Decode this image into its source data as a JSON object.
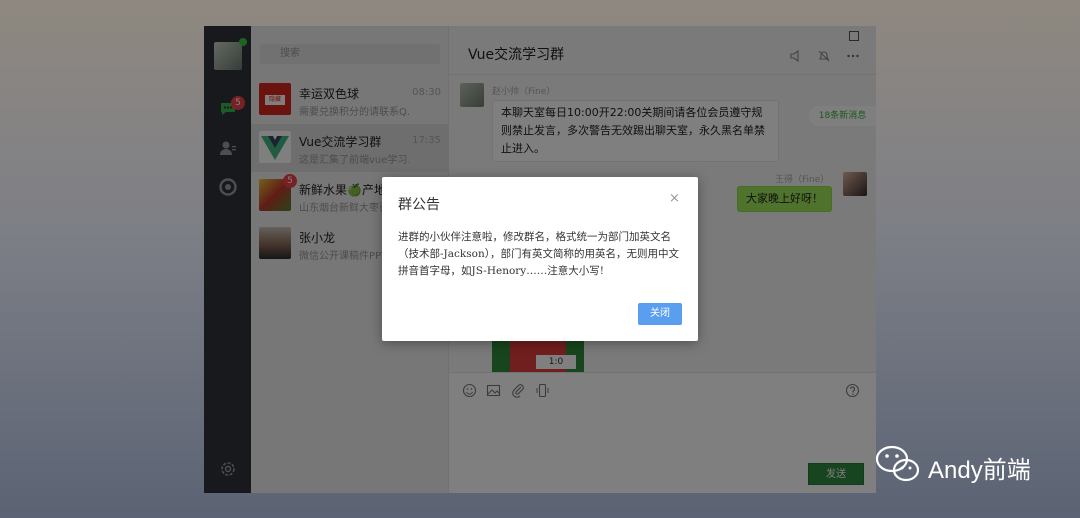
{
  "sidebar": {
    "chat_badge": "5"
  },
  "search": {
    "placeholder": "搜索"
  },
  "chats": [
    {
      "name": "幸运双色球",
      "preview": "需要兑换积分的请联系Q...",
      "time": "08:30",
      "avatar_label": "隐藏",
      "badge": ""
    },
    {
      "name": "Vue交流学习群",
      "preview": "这是汇集了前端vue学习...",
      "time": "17:35",
      "avatar_label": "",
      "badge": ""
    },
    {
      "name": "新鲜水果🍏产地直",
      "preview": "山东烟台新鲜大枣已...",
      "time": "",
      "avatar_label": "",
      "badge": "5"
    },
    {
      "name": "张小龙",
      "preview": "微信公开课稿件PPT...",
      "time": "",
      "avatar_label": "",
      "badge": ""
    }
  ],
  "chat": {
    "title": "Vue交流学习群",
    "new_messages": "18条新消息",
    "messages": [
      {
        "sender": "赵小帅（Fine）",
        "text": "本聊天室每日10:00开22:00关期间请各位会员遵守规则禁止发言，多次警告无效踢出聊天室，永久黑名单禁止进入。"
      },
      {
        "sender": "王得（Fine）",
        "text": "大家晚上好呀！"
      }
    ],
    "image_score": "1:0",
    "send_label": "发送"
  },
  "dialog": {
    "title": "群公告",
    "close_symbol": "×",
    "body": "进群的小伙伴注意啦，修改群名，格式统一为部门加英文名（技术部-Jackson），部门有英文简称的用英名，无则用中文拼音首字母，如JS-Henory……注意大小写!",
    "button_label": "关闭"
  },
  "watermark": {
    "text": "Andy前端"
  },
  "colors": {
    "accent_green": "#2e8b3e",
    "dialog_button": "#5a9ef0",
    "badge_red": "#f0434a",
    "sidebar": "#2e3238"
  }
}
